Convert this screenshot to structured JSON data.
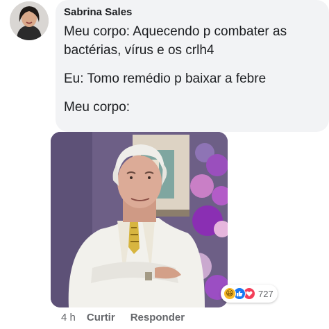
{
  "comment": {
    "author": "Sabrina Sales",
    "lines": [
      "Meu corpo: Aquecendo p combater as bactérias, vírus e os crlh4",
      "Eu: Tomo remédio p baixar a febre",
      "Meu corpo:"
    ]
  },
  "reactions": {
    "icons": [
      "haha-icon",
      "like-icon",
      "love-icon"
    ],
    "count": "727"
  },
  "actions": {
    "time": "4 h",
    "like_label": "Curtir",
    "reply_label": "Responder"
  },
  "colors": {
    "bubble_bg": "#f2f3f5",
    "like": "#1877f2",
    "love": "#f33e58",
    "haha": "#f7b928",
    "meta_text": "#65676b"
  }
}
